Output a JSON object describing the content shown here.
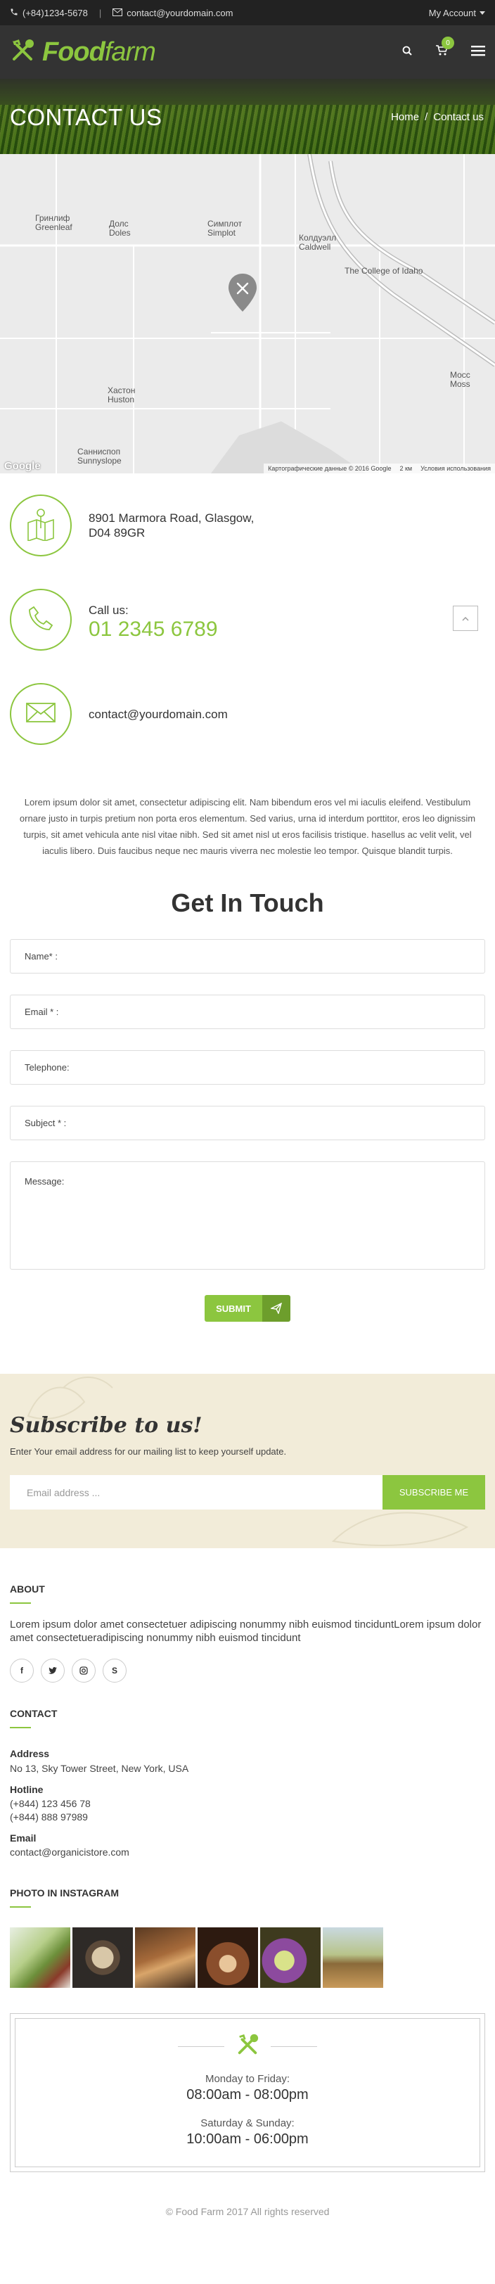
{
  "topbar": {
    "phone": "(+84)1234-5678",
    "email": "contact@yourdomain.com",
    "account_label": "My Account"
  },
  "header": {
    "logo_bold": "Food",
    "logo_light": "farm",
    "cart_count": "0"
  },
  "banner": {
    "title": "CONTACT US",
    "crumb_home": "Home",
    "crumb_sep": "/",
    "crumb_current": "Contact us"
  },
  "map": {
    "labels": {
      "greenleaf": "Гринлиф\nGreenleaf",
      "doles": "Долс\nDoles",
      "simplot": "Симплот\nSimplot",
      "caldwell": "Колдуэлл\nCaldwell",
      "college": "The College of Idaho",
      "huston": "Хастон\nHuston",
      "sunnyslope": "Санниспоп\nSunnyslope",
      "moss": "Мосс\nMoss"
    },
    "footer_data": "Картографические данные © 2016 Google",
    "footer_scale": "2 км",
    "footer_terms": "Условия использования",
    "google": "Google"
  },
  "contact": {
    "address_line1": "8901 Marmora Road, Glasgow,",
    "address_line2": "D04 89GR",
    "call_label": "Call us:",
    "call_number": "01 2345 6789",
    "email": "contact@yourdomain.com"
  },
  "lorem": "Lorem ipsum dolor sit amet, consectetur adipiscing elit. Nam bibendum eros vel mi iaculis eleifend. Vestibulum ornare justo in turpis pretium non porta eros elementum. Sed varius, urna id interdum porttitor, eros leo dignissim turpis, sit amet vehicula ante nisl vitae nibh. Sed sit amet nisl ut eros facilisis tristique. hasellus ac velit velit, vel iaculis libero. Duis faucibus neque nec mauris viverra nec molestie leo tempor. Quisque blandit turpis.",
  "form": {
    "title_light": "Get In",
    "title_bold": "Touch",
    "name_label": "Name* :",
    "email_label": "Email * :",
    "phone_label": "Telephone:",
    "subject_label": "Subject * :",
    "message_label": "Message:",
    "submit_label": "SUBMIT"
  },
  "subscribe": {
    "title": "Subscribe to us!",
    "text": "Enter Your email address for our mailing list to keep yourself update.",
    "placeholder": "Email address ...",
    "button": "SUBSCRIBE ME"
  },
  "footer": {
    "about_title": "ABOUT",
    "about_text": "Lorem ipsum dolor amet consectetuer adipiscing nonummy nibh euismod tinciduntLorem ipsum dolor amet consectetueradipiscing nonummy nibh euismod tincidunt",
    "contact_title": "CONTACT",
    "address_label": "Address",
    "address_value": "No 13, Sky Tower Street, New York, USA",
    "hotline_label": "Hotline",
    "hotline_1": "(+844) 123 456 78",
    "hotline_2": "(+844) 888 97989",
    "email_label": "Email",
    "email_value": "contact@organicistore.com",
    "instagram_title": "PHOTO IN INSTAGRAM",
    "hours_weekday_label": "Monday to Friday:",
    "hours_weekday_time": "08:00am - 08:00pm",
    "hours_weekend_label": "Saturday & Sunday:",
    "hours_weekend_time": "10:00am - 06:00pm",
    "copyright": "© Food Farm 2017 All rights reserved"
  },
  "colors": {
    "accent": "#8cc63f",
    "topbar_bg": "#222222",
    "header_bg": "#333333",
    "subscribe_bg": "#f2ecd9"
  }
}
